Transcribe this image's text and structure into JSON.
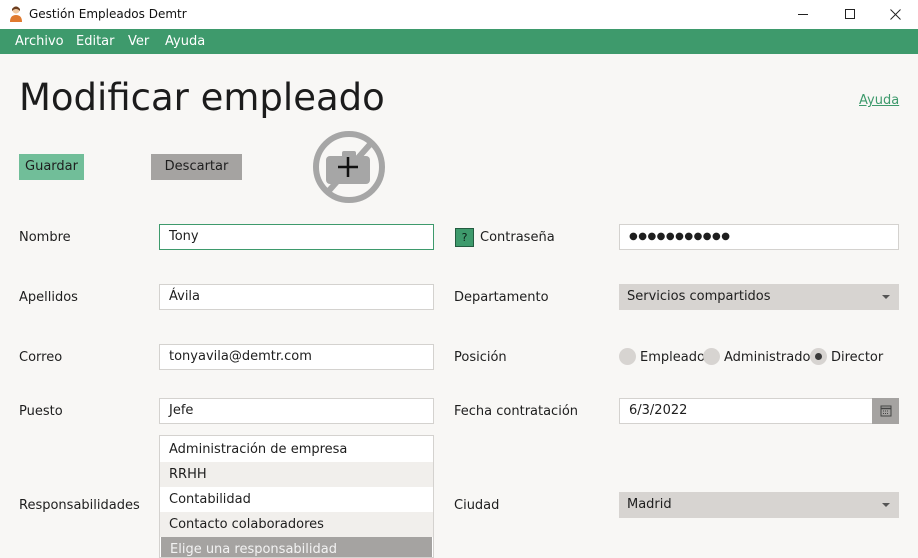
{
  "window": {
    "title": "Gestión Empleados Demtr"
  },
  "menu": {
    "items": [
      "Archivo",
      "Editar",
      "Ver",
      "Ayuda"
    ]
  },
  "page": {
    "title": "Modificar empleado",
    "help": "Ayuda"
  },
  "actions": {
    "save": "Guardar",
    "discard": "Descartar"
  },
  "photo": {
    "icon": "add-photo-icon"
  },
  "form": {
    "nombre": {
      "label": "Nombre",
      "value": "Tony"
    },
    "apellidos": {
      "label": "Apellidos",
      "value": "Ávila"
    },
    "correo": {
      "label": "Correo",
      "value": "tonyavila@demtr.com"
    },
    "puesto": {
      "label": "Puesto",
      "value": "Jefe"
    },
    "responsabilidades": {
      "label": "Responsabilidades",
      "options": [
        "Administración de empresa",
        "RRHH",
        "Contabilidad",
        "Contacto colaboradores"
      ],
      "placeholder": "Elige una responsabilidad"
    },
    "contrasena": {
      "label": "Contraseña",
      "value": "●●●●●●●●●●●",
      "help_button": "?"
    },
    "departamento": {
      "label": "Departamento",
      "value": "Servicios compartidos"
    },
    "posicion": {
      "label": "Posición",
      "options": [
        "Empleado",
        "Administrador",
        "Director"
      ],
      "selected": "Director"
    },
    "fecha": {
      "label": "Fecha contratación",
      "value": "6/3/2022"
    },
    "ciudad": {
      "label": "Ciudad",
      "value": "Madrid"
    }
  },
  "colors": {
    "accent": "#3e9a6c",
    "save_button": "#71be99",
    "neutral_button": "#a5a3a1",
    "background": "#f8f7f5"
  }
}
